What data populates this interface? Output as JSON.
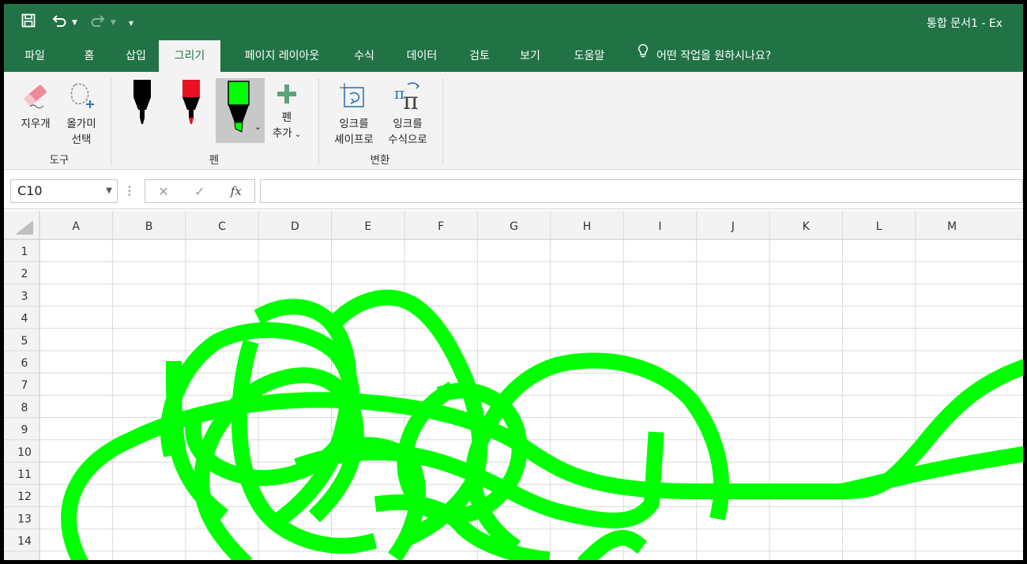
{
  "window": {
    "title": "통합 문서1  -  Ex"
  },
  "ribbon_tabs": [
    "파일",
    "홈",
    "삽입",
    "그리기",
    "페이지 레이아웃",
    "수식",
    "데이터",
    "검토",
    "보기",
    "도움말"
  ],
  "active_tab": "그리기",
  "tell_me": "어떤 작업을 원하시나요?",
  "groups": {
    "tools": {
      "label": "도구",
      "eraser": "지우개",
      "lasso_line1": "올가미",
      "lasso_line2": "선택"
    },
    "pens": {
      "label": "펜",
      "add_pen_line1": "펜",
      "add_pen_line2": "추가",
      "pen_colors": [
        "#000000",
        "#e81123",
        "#00ff00"
      ]
    },
    "convert": {
      "label": "변환",
      "ink_to_shape_line1": "잉크를",
      "ink_to_shape_line2": "셰이프로",
      "ink_to_math_line1": "잉크를",
      "ink_to_math_line2": "수식으로"
    }
  },
  "formula_bar": {
    "name_box": "C10",
    "formula": ""
  },
  "grid": {
    "columns": [
      "A",
      "B",
      "C",
      "D",
      "E",
      "F",
      "G",
      "H",
      "I",
      "J",
      "K",
      "L",
      "M"
    ],
    "rows": [
      "1",
      "2",
      "3",
      "4",
      "5",
      "6",
      "7",
      "8",
      "9",
      "10",
      "11",
      "12",
      "13",
      "14"
    ]
  },
  "ink": {
    "color": "#00ff00"
  },
  "colors": {
    "accent": "#217346",
    "ribbon_bg": "#f3f3f3",
    "gridline": "#d9d9d9"
  }
}
